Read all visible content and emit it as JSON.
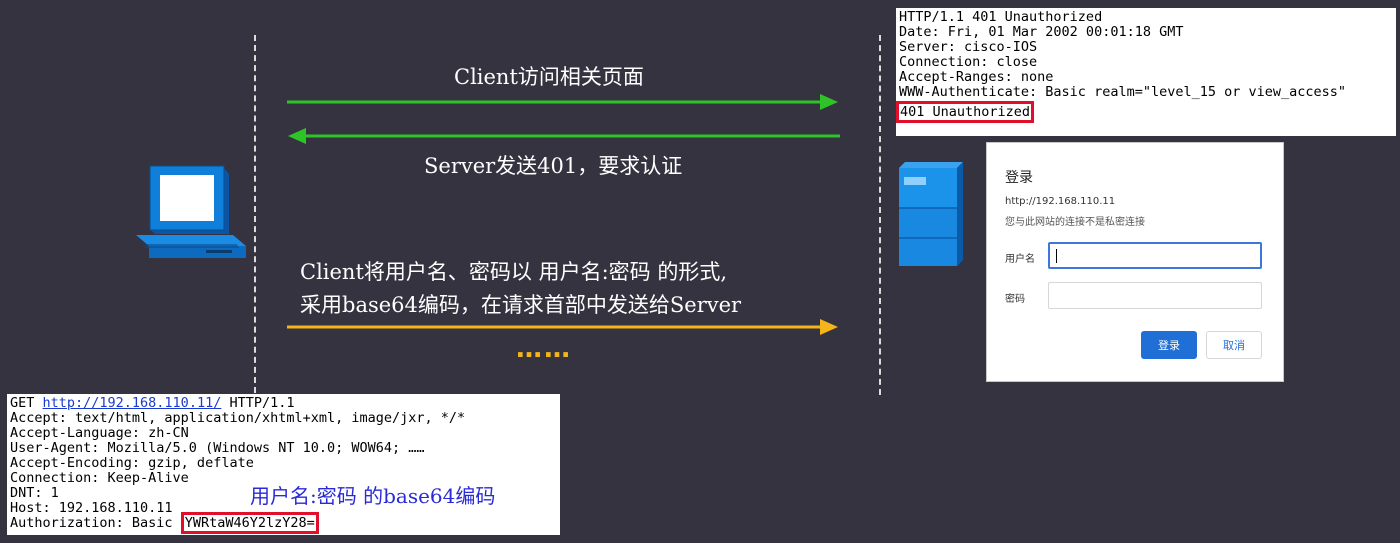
{
  "arrows": {
    "client_request_label": "Client访问相关页面",
    "server_response_label": "Server发送401，要求认证",
    "client_auth_label_line1": "Client将用户名、密码以 用户名:密码 的形式,",
    "client_auth_label_line2": "采用base64编码，在请求首部中发送给Server",
    "continuation": "……",
    "colors": {
      "request": "#2ec427",
      "auth": "#f4b41a"
    }
  },
  "response": {
    "lines": [
      "HTTP/1.1 401 Unauthorized",
      "Date: Fri, 01 Mar 2002 00:01:18 GMT",
      "Server: cisco-IOS",
      "Connection: close",
      "Accept-Ranges: none",
      "WWW-Authenticate: Basic realm=\"level_15 or view_access\""
    ],
    "highlight": "401 Unauthorized"
  },
  "dialog": {
    "title": "登录",
    "url": "http://192.168.110.11",
    "warning": "您与此网站的连接不是私密连接",
    "username_label": "用户名",
    "password_label": "密码",
    "username_value": "",
    "password_value": "",
    "login_button": "登录",
    "cancel_button": "取消"
  },
  "request": {
    "get_prefix": "GET ",
    "get_url": "http://192.168.110.11/",
    "get_suffix": " HTTP/1.1",
    "lines": [
      "Accept: text/html, application/xhtml+xml, image/jxr, */*",
      "Accept-Language: zh-CN",
      "User-Agent: Mozilla/5.0 (Windows NT 10.0; WOW64; ……",
      "Accept-Encoding: gzip, deflate",
      "Connection: Keep-Alive",
      "DNT: 1",
      "Host: 192.168.110.11"
    ],
    "auth_prefix": "Authorization: Basic ",
    "auth_value": "YWRtaW46Y2lzY28=",
    "annotation": "用户名:密码 的base64编码"
  }
}
